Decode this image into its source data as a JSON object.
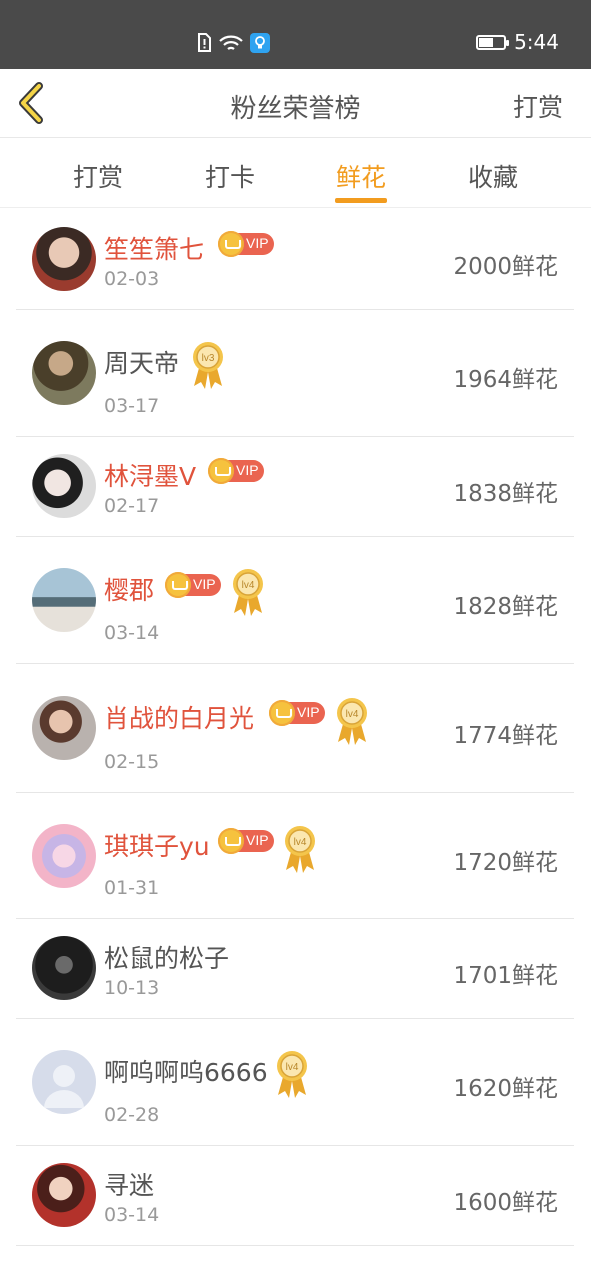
{
  "status_bar": {
    "time": "5:44",
    "battery_level": 0.6
  },
  "header": {
    "title": "粉丝荣誉榜",
    "action_label": "打赏"
  },
  "tabs": [
    {
      "label": "打赏"
    },
    {
      "label": "打卡"
    },
    {
      "label": "鲜花",
      "active": true
    },
    {
      "label": "收藏"
    }
  ],
  "vip_badge_label": "VIP",
  "rows": [
    {
      "name": "笙笙箫七",
      "date": "02-03",
      "amount": "2000鲜花",
      "vip": true,
      "level": ""
    },
    {
      "name": "周天帝",
      "date": "03-17",
      "amount": "1964鲜花",
      "vip": false,
      "level": "lv3"
    },
    {
      "name": "林浔墨V",
      "date": "02-17",
      "amount": "1838鲜花",
      "vip": true,
      "level": ""
    },
    {
      "name": "樱郡",
      "date": "03-14",
      "amount": "1828鲜花",
      "vip": true,
      "level": "lv4"
    },
    {
      "name": "肖战的白月光",
      "date": "02-15",
      "amount": "1774鲜花",
      "vip": true,
      "level": "lv4"
    },
    {
      "name": "琪琪子yu",
      "date": "01-31",
      "amount": "1720鲜花",
      "vip": true,
      "level": "lv4"
    },
    {
      "name": "松鼠的松子",
      "date": "10-13",
      "amount": "1701鲜花",
      "vip": false,
      "level": ""
    },
    {
      "name": "啊呜啊呜6666",
      "date": "02-28",
      "amount": "1620鲜花",
      "vip": false,
      "level": "lv4"
    },
    {
      "name": "寻迷",
      "date": "03-14",
      "amount": "1600鲜花",
      "vip": false,
      "level": ""
    }
  ]
}
